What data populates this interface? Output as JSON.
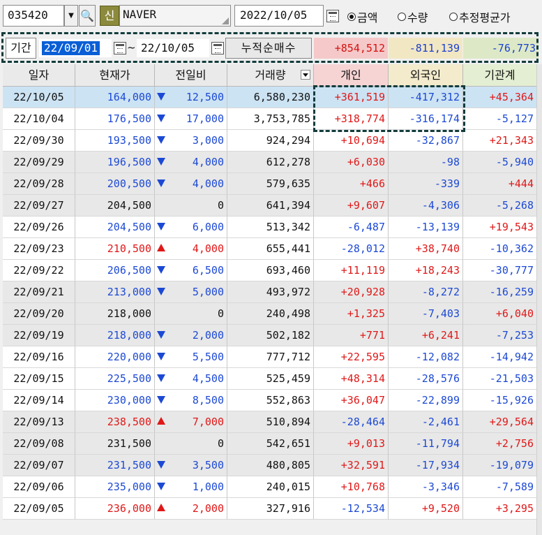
{
  "toolbar": {
    "stock_code": "035420",
    "shin_label": "신",
    "stock_name": "NAVER",
    "date": "2022/10/05",
    "radios": [
      {
        "label": "금액",
        "checked": true
      },
      {
        "label": "수량",
        "checked": false
      },
      {
        "label": "추정평균가",
        "checked": false
      }
    ]
  },
  "period": {
    "label": "기간",
    "start": "22/09/01",
    "tilde": "~",
    "end": "22/10/05",
    "cumulative_label": "누적순매수",
    "sum_individual": "+854,512",
    "sum_foreign": "-811,139",
    "sum_institution": "-76,773"
  },
  "table": {
    "headers": [
      "일자",
      "현재가",
      "전일비",
      "거래량",
      "개인",
      "외국인",
      "기관계"
    ],
    "rows": [
      {
        "date": "22/10/05",
        "price": "164,000",
        "dir": "down",
        "chg": "12,500",
        "vol": "6,580,230",
        "ind": "+361,519",
        "for": "-417,312",
        "ins": "+45,364"
      },
      {
        "date": "22/10/04",
        "price": "176,500",
        "dir": "down",
        "chg": "17,000",
        "vol": "3,753,785",
        "ind": "+318,774",
        "for": "-316,174",
        "ins": "-5,127"
      },
      {
        "date": "22/09/30",
        "price": "193,500",
        "dir": "down",
        "chg": "3,000",
        "vol": "924,294",
        "ind": "+10,694",
        "for": "-32,867",
        "ins": "+21,343"
      },
      {
        "date": "22/09/29",
        "price": "196,500",
        "dir": "down",
        "chg": "4,000",
        "vol": "612,278",
        "ind": "+6,030",
        "for": "-98",
        "ins": "-5,940"
      },
      {
        "date": "22/09/28",
        "price": "200,500",
        "dir": "down",
        "chg": "4,000",
        "vol": "579,635",
        "ind": "+466",
        "for": "-339",
        "ins": "+444"
      },
      {
        "date": "22/09/27",
        "price": "204,500",
        "dir": "flat",
        "chg": "0",
        "vol": "641,394",
        "ind": "+9,607",
        "for": "-4,306",
        "ins": "-5,268"
      },
      {
        "date": "22/09/26",
        "price": "204,500",
        "dir": "down",
        "chg": "6,000",
        "vol": "513,342",
        "ind": "-6,487",
        "for": "-13,139",
        "ins": "+19,543"
      },
      {
        "date": "22/09/23",
        "price": "210,500",
        "dir": "up",
        "chg": "4,000",
        "vol": "655,441",
        "ind": "-28,012",
        "for": "+38,740",
        "ins": "-10,362"
      },
      {
        "date": "22/09/22",
        "price": "206,500",
        "dir": "down",
        "chg": "6,500",
        "vol": "693,460",
        "ind": "+11,119",
        "for": "+18,243",
        "ins": "-30,777"
      },
      {
        "date": "22/09/21",
        "price": "213,000",
        "dir": "down",
        "chg": "5,000",
        "vol": "493,972",
        "ind": "+20,928",
        "for": "-8,272",
        "ins": "-16,259"
      },
      {
        "date": "22/09/20",
        "price": "218,000",
        "dir": "flat",
        "chg": "0",
        "vol": "240,498",
        "ind": "+1,325",
        "for": "-7,403",
        "ins": "+6,040"
      },
      {
        "date": "22/09/19",
        "price": "218,000",
        "dir": "down",
        "chg": "2,000",
        "vol": "502,182",
        "ind": "+771",
        "for": "+6,241",
        "ins": "-7,253"
      },
      {
        "date": "22/09/16",
        "price": "220,000",
        "dir": "down",
        "chg": "5,500",
        "vol": "777,712",
        "ind": "+22,595",
        "for": "-12,082",
        "ins": "-14,942"
      },
      {
        "date": "22/09/15",
        "price": "225,500",
        "dir": "down",
        "chg": "4,500",
        "vol": "525,459",
        "ind": "+48,314",
        "for": "-28,576",
        "ins": "-21,503"
      },
      {
        "date": "22/09/14",
        "price": "230,000",
        "dir": "down",
        "chg": "8,500",
        "vol": "552,863",
        "ind": "+36,047",
        "for": "-22,899",
        "ins": "-15,926"
      },
      {
        "date": "22/09/13",
        "price": "238,500",
        "dir": "up",
        "chg": "7,000",
        "vol": "510,894",
        "ind": "-28,464",
        "for": "-2,461",
        "ins": "+29,564"
      },
      {
        "date": "22/09/08",
        "price": "231,500",
        "dir": "flat",
        "chg": "0",
        "vol": "542,651",
        "ind": "+9,013",
        "for": "-11,794",
        "ins": "+2,756"
      },
      {
        "date": "22/09/07",
        "price": "231,500",
        "dir": "down",
        "chg": "3,500",
        "vol": "480,805",
        "ind": "+32,591",
        "for": "-17,934",
        "ins": "-19,079"
      },
      {
        "date": "22/09/06",
        "price": "235,000",
        "dir": "down",
        "chg": "1,000",
        "vol": "240,015",
        "ind": "+10,768",
        "for": "-3,346",
        "ins": "-7,589"
      },
      {
        "date": "22/09/05",
        "price": "236,000",
        "dir": "up",
        "chg": "2,000",
        "vol": "327,916",
        "ind": "-12,534",
        "for": "+9,520",
        "ins": "+3,295"
      }
    ]
  },
  "colors": {
    "up": "#e01818",
    "down": "#1c49d4",
    "selected_row": "#cce3f3"
  }
}
